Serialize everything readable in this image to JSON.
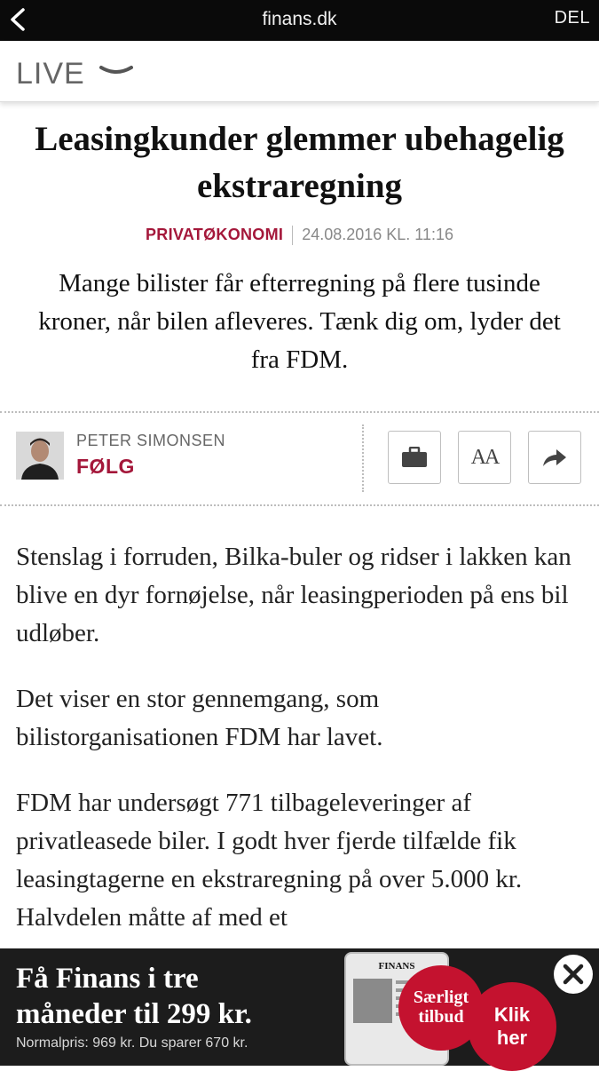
{
  "browser": {
    "domain": "finans.dk",
    "share_label": "DEL",
    "back_icon": "chevron-left-icon"
  },
  "live": {
    "label": "LIVE",
    "icon": "chevron-down-icon"
  },
  "article": {
    "headline": "Leasingkunder glemmer ubehagelig ekstraregning",
    "category": "PRIVATØKONOMI",
    "date": "24.08.2016 KL. 11:16",
    "lead": "Mange bilister får efterregning på flere tusinde kroner, når bilen afleveres. Tænk dig om, lyder det fra FDM.",
    "paragraphs": [
      "Stenslag i forruden, Bilka-buler og ridser i lakken kan blive en dyr fornøjelse, når leasingperioden på ens bil udløber.",
      "Det viser en stor gennemgang, som bilistorganisationen FDM har lavet.",
      "FDM har undersøgt 771 tilbageleveringer af privatleasede biler. I godt hver fjerde tilfælde fik leasingtagerne en ekstraregning på over 5.000 kr. Halvdelen måtte af med et"
    ]
  },
  "author": {
    "name": "PETER SIMONSEN",
    "follow_label": "FØLG"
  },
  "tools": {
    "save_icon": "briefcase-icon",
    "font_size_label": "AA",
    "share_icon": "share-arrow-icon"
  },
  "ad": {
    "title_line1": "Få Finans i tre",
    "title_line2": "måneder til 299 kr.",
    "subtitle": "Normalpris: 969 kr. Du sparer 670 kr.",
    "tablet_logo": "FINANS",
    "badge_offer_line1": "Særligt",
    "badge_offer_line2": "tilbud",
    "badge_click_line1": "Klik",
    "badge_click_line2": "her",
    "close_icon": "close-icon"
  }
}
